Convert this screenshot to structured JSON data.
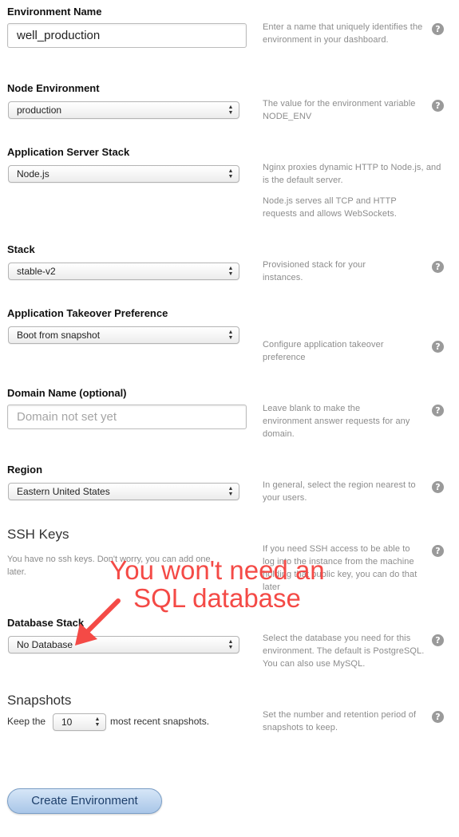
{
  "fields": {
    "env_name": {
      "label": "Environment Name",
      "value": "well_production",
      "help": "Enter a name that uniquely identifies the environment in your dashboard."
    },
    "node_env": {
      "label": "Node Environment",
      "value": "production",
      "help": "The value for the environment variable NODE_ENV"
    },
    "app_stack": {
      "label": "Application Server Stack",
      "value": "Node.js",
      "help": "Nginx proxies dynamic HTTP to Node.js, and is the default server.",
      "help2": "Node.js serves all TCP and HTTP requests and allows WebSockets."
    },
    "stack": {
      "label": "Stack",
      "value": "stable-v2",
      "help": "Provisioned stack for your instances."
    },
    "takeover": {
      "label": "Application Takeover Preference",
      "value": "Boot from snapshot",
      "help": "Configure application takeover preference"
    },
    "domain": {
      "label": "Domain Name (optional)",
      "placeholder": "Domain not set yet",
      "help": "Leave blank to make the environment answer requests for any domain."
    },
    "region": {
      "label": "Region",
      "value": "Eastern United States",
      "help": "In general, select the region nearest to your users."
    },
    "ssh": {
      "title": "SSH Keys",
      "message": "You have no ssh keys. Don't worry, you can add one later.",
      "help": "If you need SSH access to be able to log into the instance from the machine holding that public key, you can do that later"
    },
    "db_stack": {
      "label": "Database Stack",
      "value": "No Database",
      "help": "Select the database you need for this environment. The default is PostgreSQL. You can also use MySQL."
    },
    "snapshots": {
      "title": "Snapshots",
      "prefix": "Keep the",
      "value": "10",
      "suffix": "most recent snapshots.",
      "help": "Set the number and retention period of snapshots to keep."
    }
  },
  "help_icon": "?",
  "submit_label": "Create Environment",
  "annotation": {
    "text": "You won't need an SQL database",
    "color": "#f44a46"
  },
  "colors": {
    "annotation": "#f44a46",
    "button_text": "#1d3f6b",
    "help_text": "#8c8c8c"
  }
}
